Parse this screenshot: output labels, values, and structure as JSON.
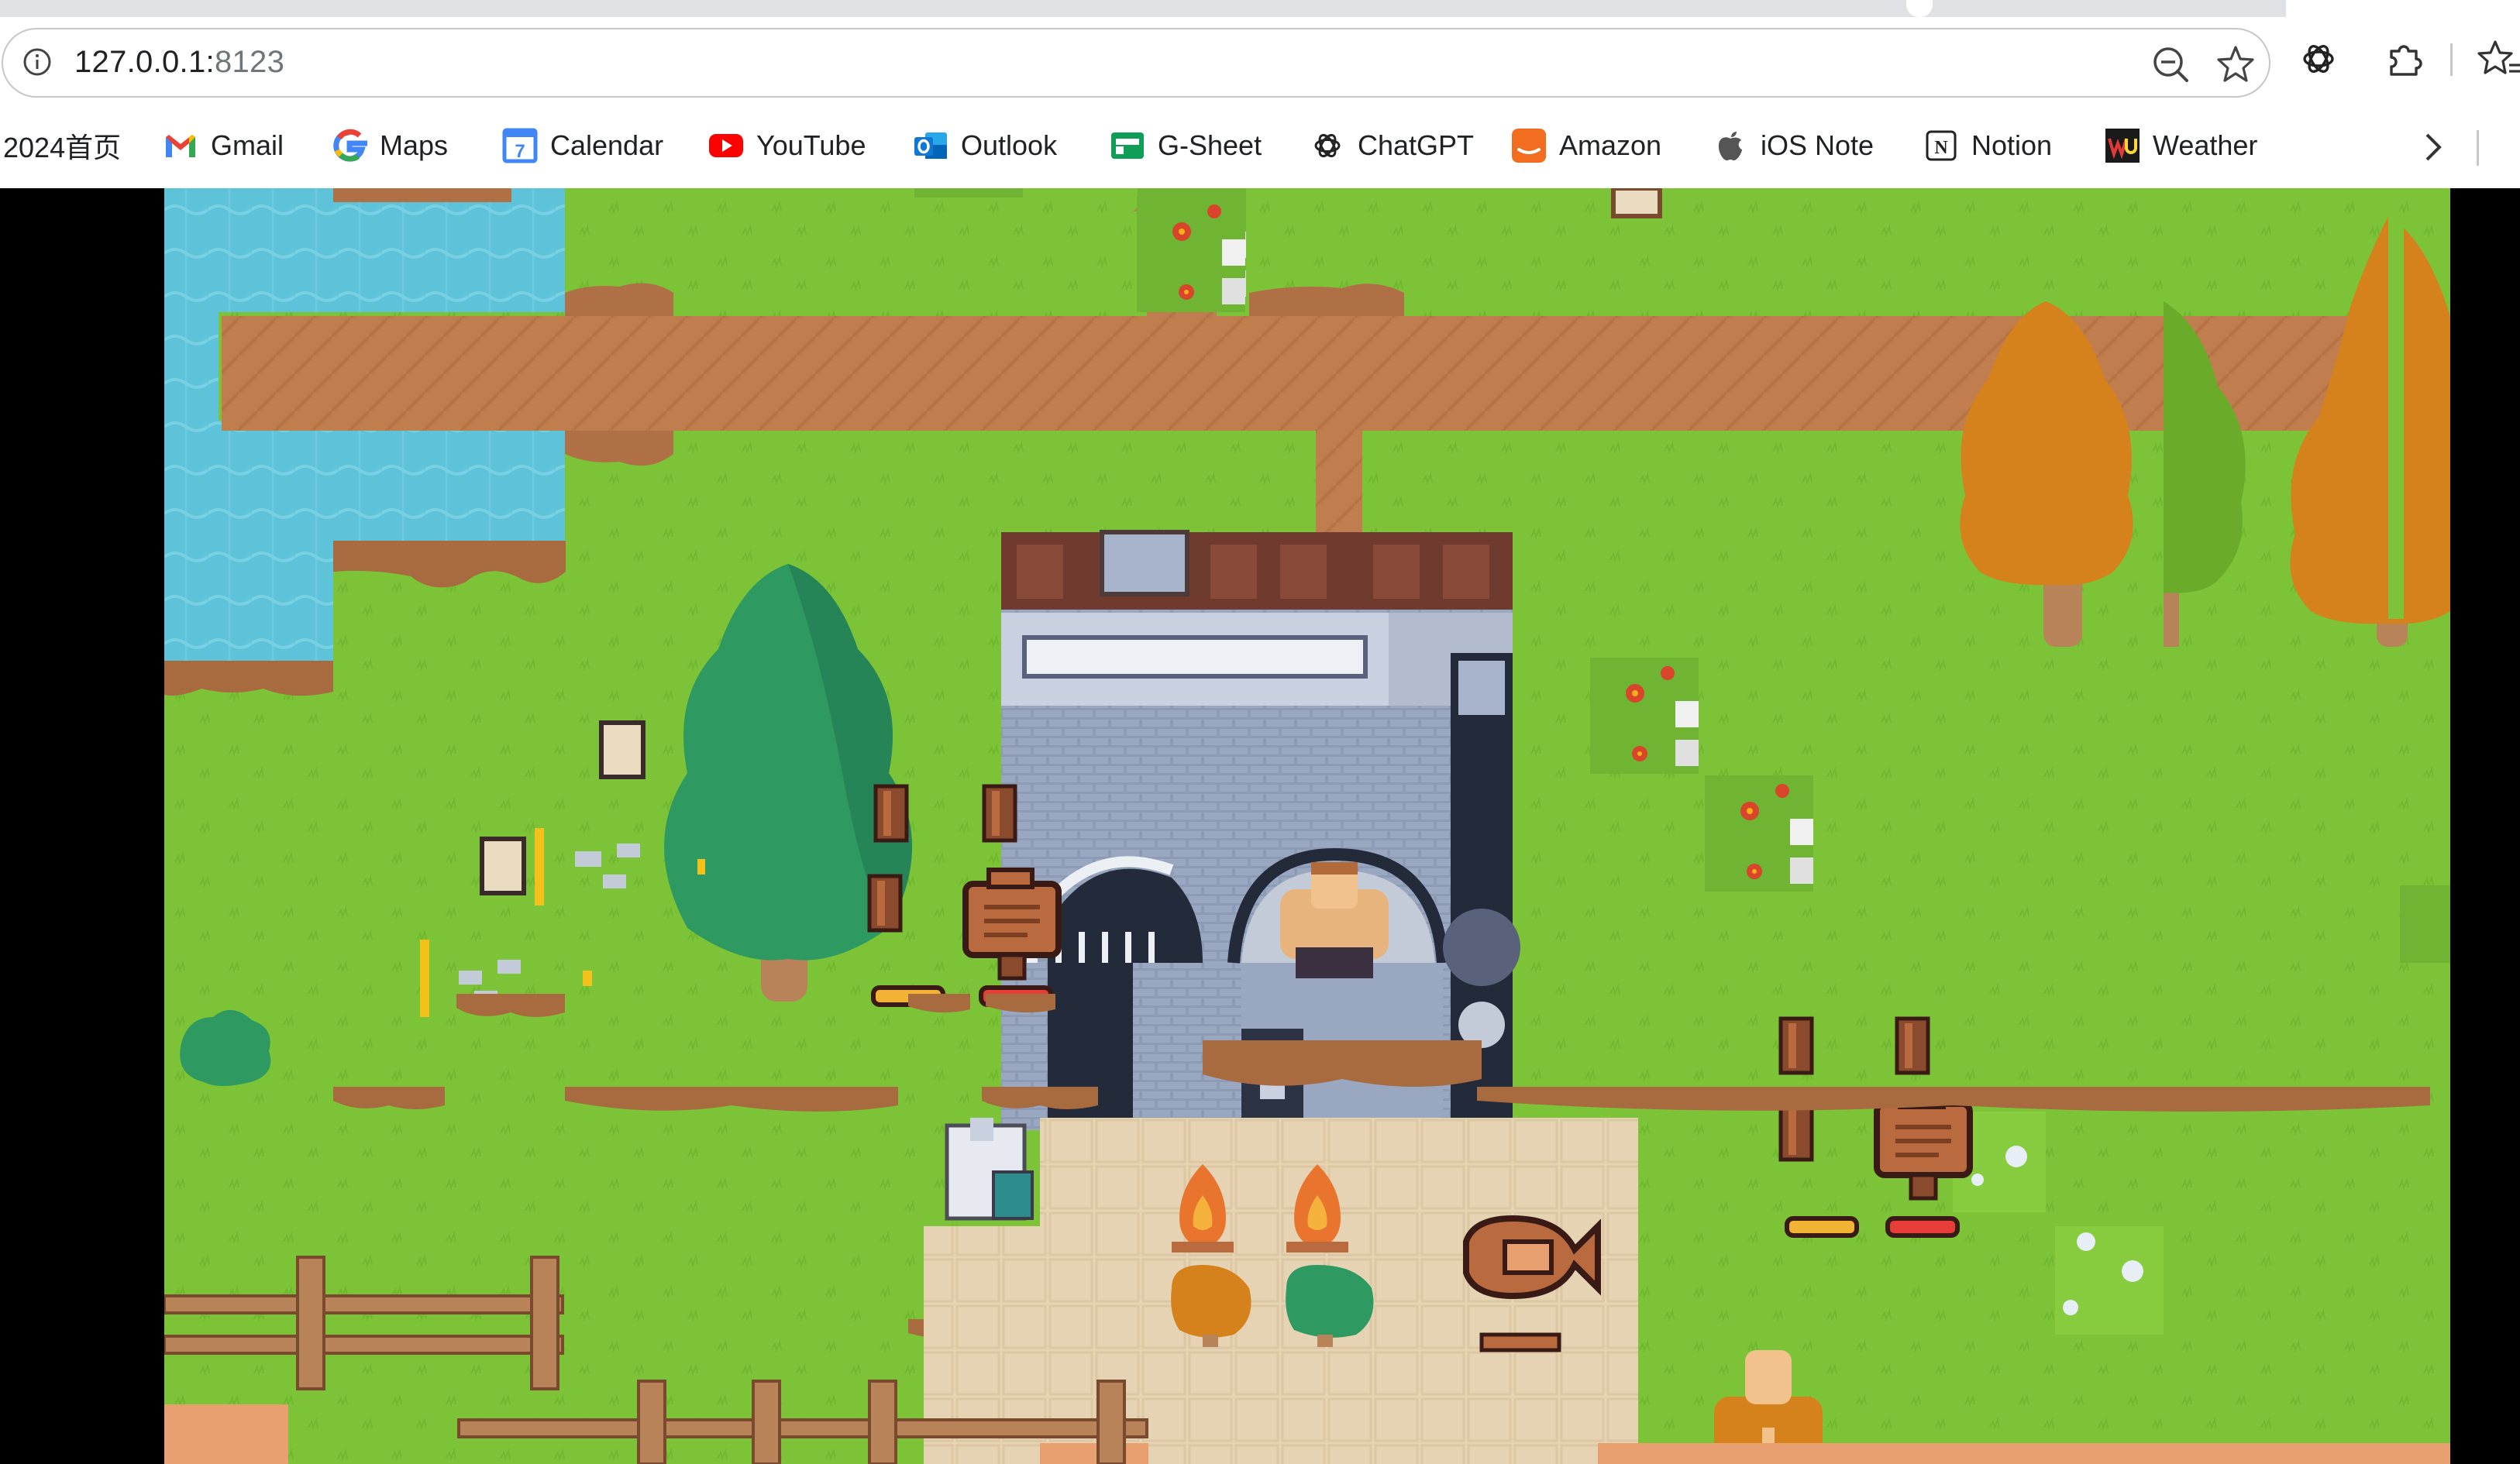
{
  "browser": {
    "url_host": "127.0.0.1:",
    "url_port": "8123",
    "icons": {
      "site_info": "info-icon",
      "zoom": "zoom-out-icon",
      "bookmark": "star-icon",
      "chatgpt_ext": "openai-icon",
      "extensions": "puzzle-icon",
      "reading_list": "favorites-icon"
    },
    "bookmarks": [
      {
        "label": "2024首页",
        "icon": ""
      },
      {
        "label": "Gmail",
        "icon": "gmail-icon"
      },
      {
        "label": "Maps",
        "icon": "google-icon"
      },
      {
        "label": "Calendar",
        "icon": "calendar-icon"
      },
      {
        "label": "YouTube",
        "icon": "youtube-icon"
      },
      {
        "label": "Outlook",
        "icon": "outlook-icon"
      },
      {
        "label": "G-Sheet",
        "icon": "sheets-icon"
      },
      {
        "label": "ChatGPT",
        "icon": "openai-icon"
      },
      {
        "label": "Amazon",
        "icon": "amazon-icon"
      },
      {
        "label": "iOS Note",
        "icon": "apple-icon"
      },
      {
        "label": "Notion",
        "icon": "notion-icon"
      },
      {
        "label": "Weather",
        "icon": "weather-icon"
      }
    ],
    "calendar_day": "7",
    "notion_letter": "N"
  },
  "game": {
    "scene": "pixel-art-village",
    "colors": {
      "grass": "#7cc337",
      "water": "#5ec3d9",
      "path": "#c07e4f",
      "plaza": "#e6d3b3",
      "stone": "#8e9bb5",
      "roof": "#6e3b2e"
    }
  }
}
